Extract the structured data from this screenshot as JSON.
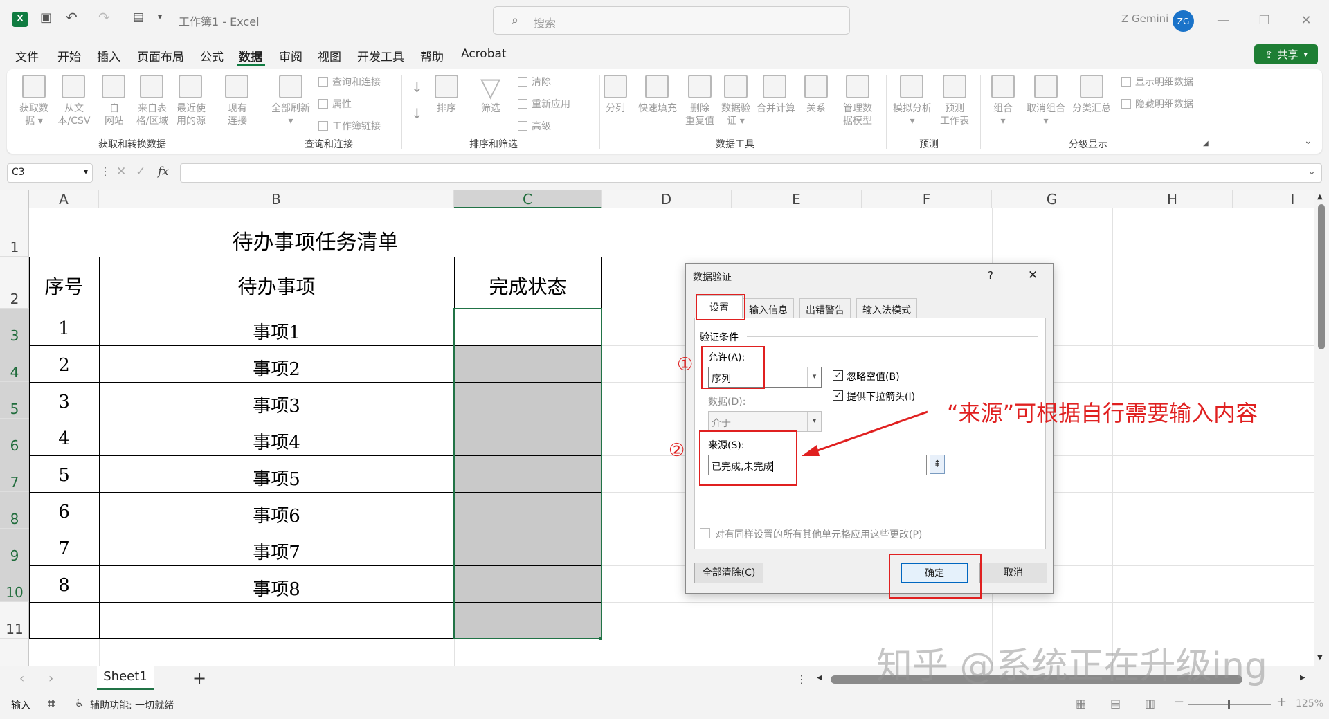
{
  "titlebar": {
    "title": "工作簿1  -  Excel",
    "search_placeholder": "搜索",
    "user": "Z Gemini",
    "avatar": "ZG"
  },
  "menu": {
    "items": [
      "文件",
      "开始",
      "插入",
      "页面布局",
      "公式",
      "数据",
      "审阅",
      "视图",
      "开发工具",
      "帮助",
      "Acrobat"
    ],
    "active": "数据",
    "share": "共享"
  },
  "ribbon": {
    "get_transform": {
      "buttons": [
        [
          "获取数",
          "据 ▾"
        ],
        [
          "从文",
          "本/CSV"
        ],
        [
          "自",
          "网站"
        ],
        [
          "来自表",
          "格/区域"
        ],
        [
          "最近使",
          "用的源"
        ],
        [
          "现有",
          "连接"
        ]
      ],
      "group": "获取和转换数据"
    },
    "queries": {
      "refresh": [
        "全部刷新",
        "▾"
      ],
      "small": [
        "查询和连接",
        "属性",
        "工作簿链接"
      ],
      "group": "查询和连接"
    },
    "sort_filter": {
      "sort": "排序",
      "filter": "筛选",
      "small": [
        "清除",
        "重新应用",
        "高级"
      ],
      "group": "排序和筛选"
    },
    "data_tools": {
      "buttons": [
        [
          "分列"
        ],
        [
          "快速填充"
        ],
        [
          "删除",
          "重复值"
        ],
        [
          "数据验",
          "证 ▾"
        ],
        [
          "合并计算"
        ],
        [
          "关系"
        ],
        [
          "管理数",
          "据模型"
        ]
      ],
      "group": "数据工具"
    },
    "forecast": {
      "buttons": [
        [
          "模拟分析",
          "▾"
        ],
        [
          "预测",
          "工作表"
        ]
      ],
      "group": "预测"
    },
    "outline": {
      "buttons": [
        [
          "组合",
          "▾"
        ],
        [
          "取消组合",
          "▾"
        ],
        [
          "分类汇总"
        ]
      ],
      "small": [
        "显示明细数据",
        "隐藏明细数据"
      ],
      "group": "分级显示"
    }
  },
  "formula": {
    "namebox": "C3",
    "fx": "fx",
    "value": ""
  },
  "grid": {
    "columns": [
      "A",
      "B",
      "C",
      "D",
      "E",
      "F",
      "G",
      "H",
      "I"
    ],
    "rows": [
      "1",
      "2",
      "3",
      "4",
      "5",
      "6",
      "7",
      "8",
      "9",
      "10",
      "11"
    ],
    "title": "待办事项任务清单",
    "headers": [
      "序号",
      "待办事项",
      "完成状态"
    ],
    "data": [
      [
        "1",
        "事项1"
      ],
      [
        "2",
        "事项2"
      ],
      [
        "3",
        "事项3"
      ],
      [
        "4",
        "事项4"
      ],
      [
        "5",
        "事项5"
      ],
      [
        "6",
        "事项6"
      ],
      [
        "7",
        "事项7"
      ],
      [
        "8",
        "事项8"
      ]
    ]
  },
  "sheets": {
    "tab": "Sheet1",
    "add": "+"
  },
  "status": {
    "mode": "输入",
    "accessibility": "辅助功能: 一切就绪",
    "zoom": "125%"
  },
  "dialog": {
    "title": "数据验证",
    "help": "?",
    "close": "✕",
    "tabs": [
      "设置",
      "输入信息",
      "出错警告",
      "输入法模式"
    ],
    "section": "验证条件",
    "allow_label": "允许(A):",
    "allow_value": "序列",
    "data_label": "数据(D):",
    "data_value": "介于",
    "ignore_blank": "忽略空值(B)",
    "dropdown": "提供下拉箭头(I)",
    "source_label": "来源(S):",
    "source_value": "已完成,未完成",
    "apply_all": "对有同样设置的所有其他单元格应用这些更改(P)",
    "clear_all": "全部清除(C)",
    "ok": "确定",
    "cancel": "取消"
  },
  "annotations": {
    "n1": "①",
    "n2": "②",
    "note": "“来源”可根据自行需要输入内容"
  },
  "watermark": "知乎 @系统正在升级ing"
}
